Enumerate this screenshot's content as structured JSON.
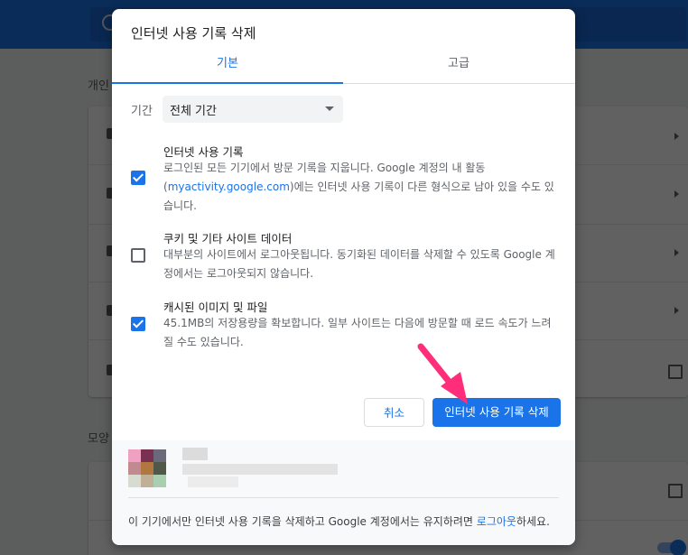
{
  "background": {
    "section_privacy": "개인",
    "section_appearance": "모양"
  },
  "dialog": {
    "title": "인터넷 사용 기록 삭제",
    "tabs": [
      {
        "label": "기본",
        "active": true
      },
      {
        "label": "고급",
        "active": false
      }
    ],
    "time_range": {
      "label": "기간",
      "selected": "전체 기간"
    },
    "options": [
      {
        "title": "인터넷 사용 기록",
        "checked": true,
        "desc_line1": "로그인된 모든 기기에서 방문 기록을 지웁니다. Google 계정의 내 활동",
        "desc_prefix": "(",
        "desc_link": "myactivity.google.com",
        "desc_suffix": ")에는 인터넷 사용 기록이 다른 형식으로 남아 있을 수도 있",
        "desc_line3": "습니다."
      },
      {
        "title": "쿠키 및 기타 사이트 데이터",
        "checked": false,
        "desc_line1": "대부분의 사이트에서 로그아웃됩니다. 동기화된 데이터를 삭제할 수 있도록 Google 계",
        "desc_line2": "정에서는 로그아웃되지 않습니다."
      },
      {
        "title": "캐시된 이미지 및 파일",
        "checked": true,
        "desc_line1": "45.1MB의 저장용량을 확보합니다. 일부 사이트는 다음에 방문할 때 로드 속도가 느려",
        "desc_line2": "질 수도 있습니다."
      }
    ],
    "buttons": {
      "cancel": "취소",
      "delete": "인터넷 사용 기록 삭제"
    },
    "footer": {
      "text_before": "이 기기에서만 인터넷 사용 기록을 삭제하고 Google 계정에서는 유지하려면 ",
      "link": "로그아웃",
      "text_after": "하세요."
    }
  },
  "colors": {
    "accent": "#1a73e8",
    "annotation_arrow": "#ff2d7a"
  },
  "icons": {
    "checkbox_checked": "check-icon",
    "dropdown": "caret-down-icon",
    "row_arrow": "chevron-right-icon",
    "external": "external-link-icon"
  }
}
